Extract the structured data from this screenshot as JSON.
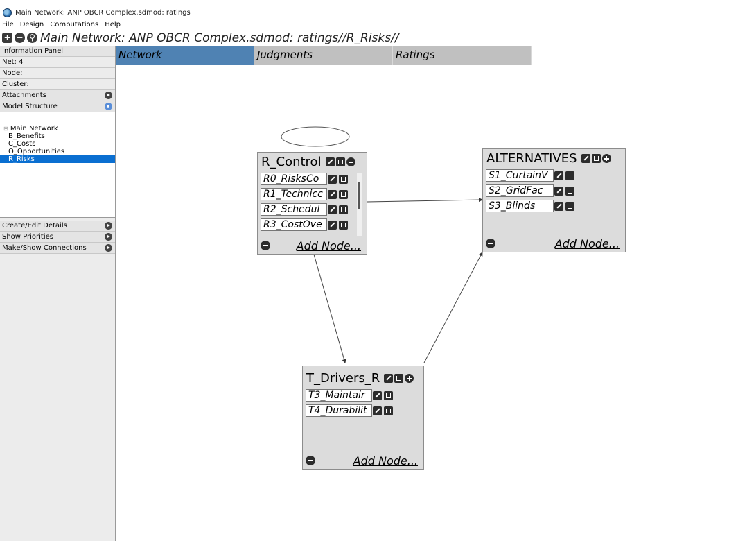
{
  "window": {
    "title": "Main Network: ANP OBCR Complex.sdmod: ratings"
  },
  "menu": [
    "File",
    "Design",
    "Computations",
    "Help"
  ],
  "path": {
    "text": "Main Network: ANP OBCR Complex.sdmod: ratings//R_Risks//"
  },
  "left_panel": {
    "info_header": "Information Panel",
    "net": "Net: 4",
    "node": "Node:",
    "cluster": "Cluster:",
    "attachments": "Attachments",
    "model_structure": "Model Structure",
    "tree": {
      "root": "Main Network",
      "items": [
        "B_Benefits",
        "C_Costs",
        "O_Opportunities",
        "R_Risks"
      ],
      "selected": "R_Risks"
    },
    "create_edit": "Create/Edit Details",
    "show_priorities": "Show Priorities",
    "make_show_connections": "Make/Show Connections"
  },
  "tabs": [
    "Network",
    "Judgments",
    "Ratings"
  ],
  "active_tab": "Network",
  "clusters": {
    "r_control": {
      "title": "R_Control",
      "nodes": [
        "R0_RisksCo",
        "R1_Technicc",
        "R2_Schedul",
        "R3_CostOve"
      ],
      "add_label": "Add Node..."
    },
    "alternatives": {
      "title": "ALTERNATIVES",
      "nodes": [
        "S1_CurtainV",
        "S2_GridFac",
        "S3_Blinds"
      ],
      "add_label": "Add Node..."
    },
    "t_drivers": {
      "title": "T_Drivers_R",
      "nodes": [
        "T3_Maintair",
        "T4_Durabilit"
      ],
      "add_label": "Add Node..."
    }
  },
  "colors": {
    "active_tab": "#4f82b3",
    "inactive_tab": "#c0c0c0",
    "selected_tree": "#0a6fd1",
    "cluster_bg": "#dcdcdc"
  }
}
